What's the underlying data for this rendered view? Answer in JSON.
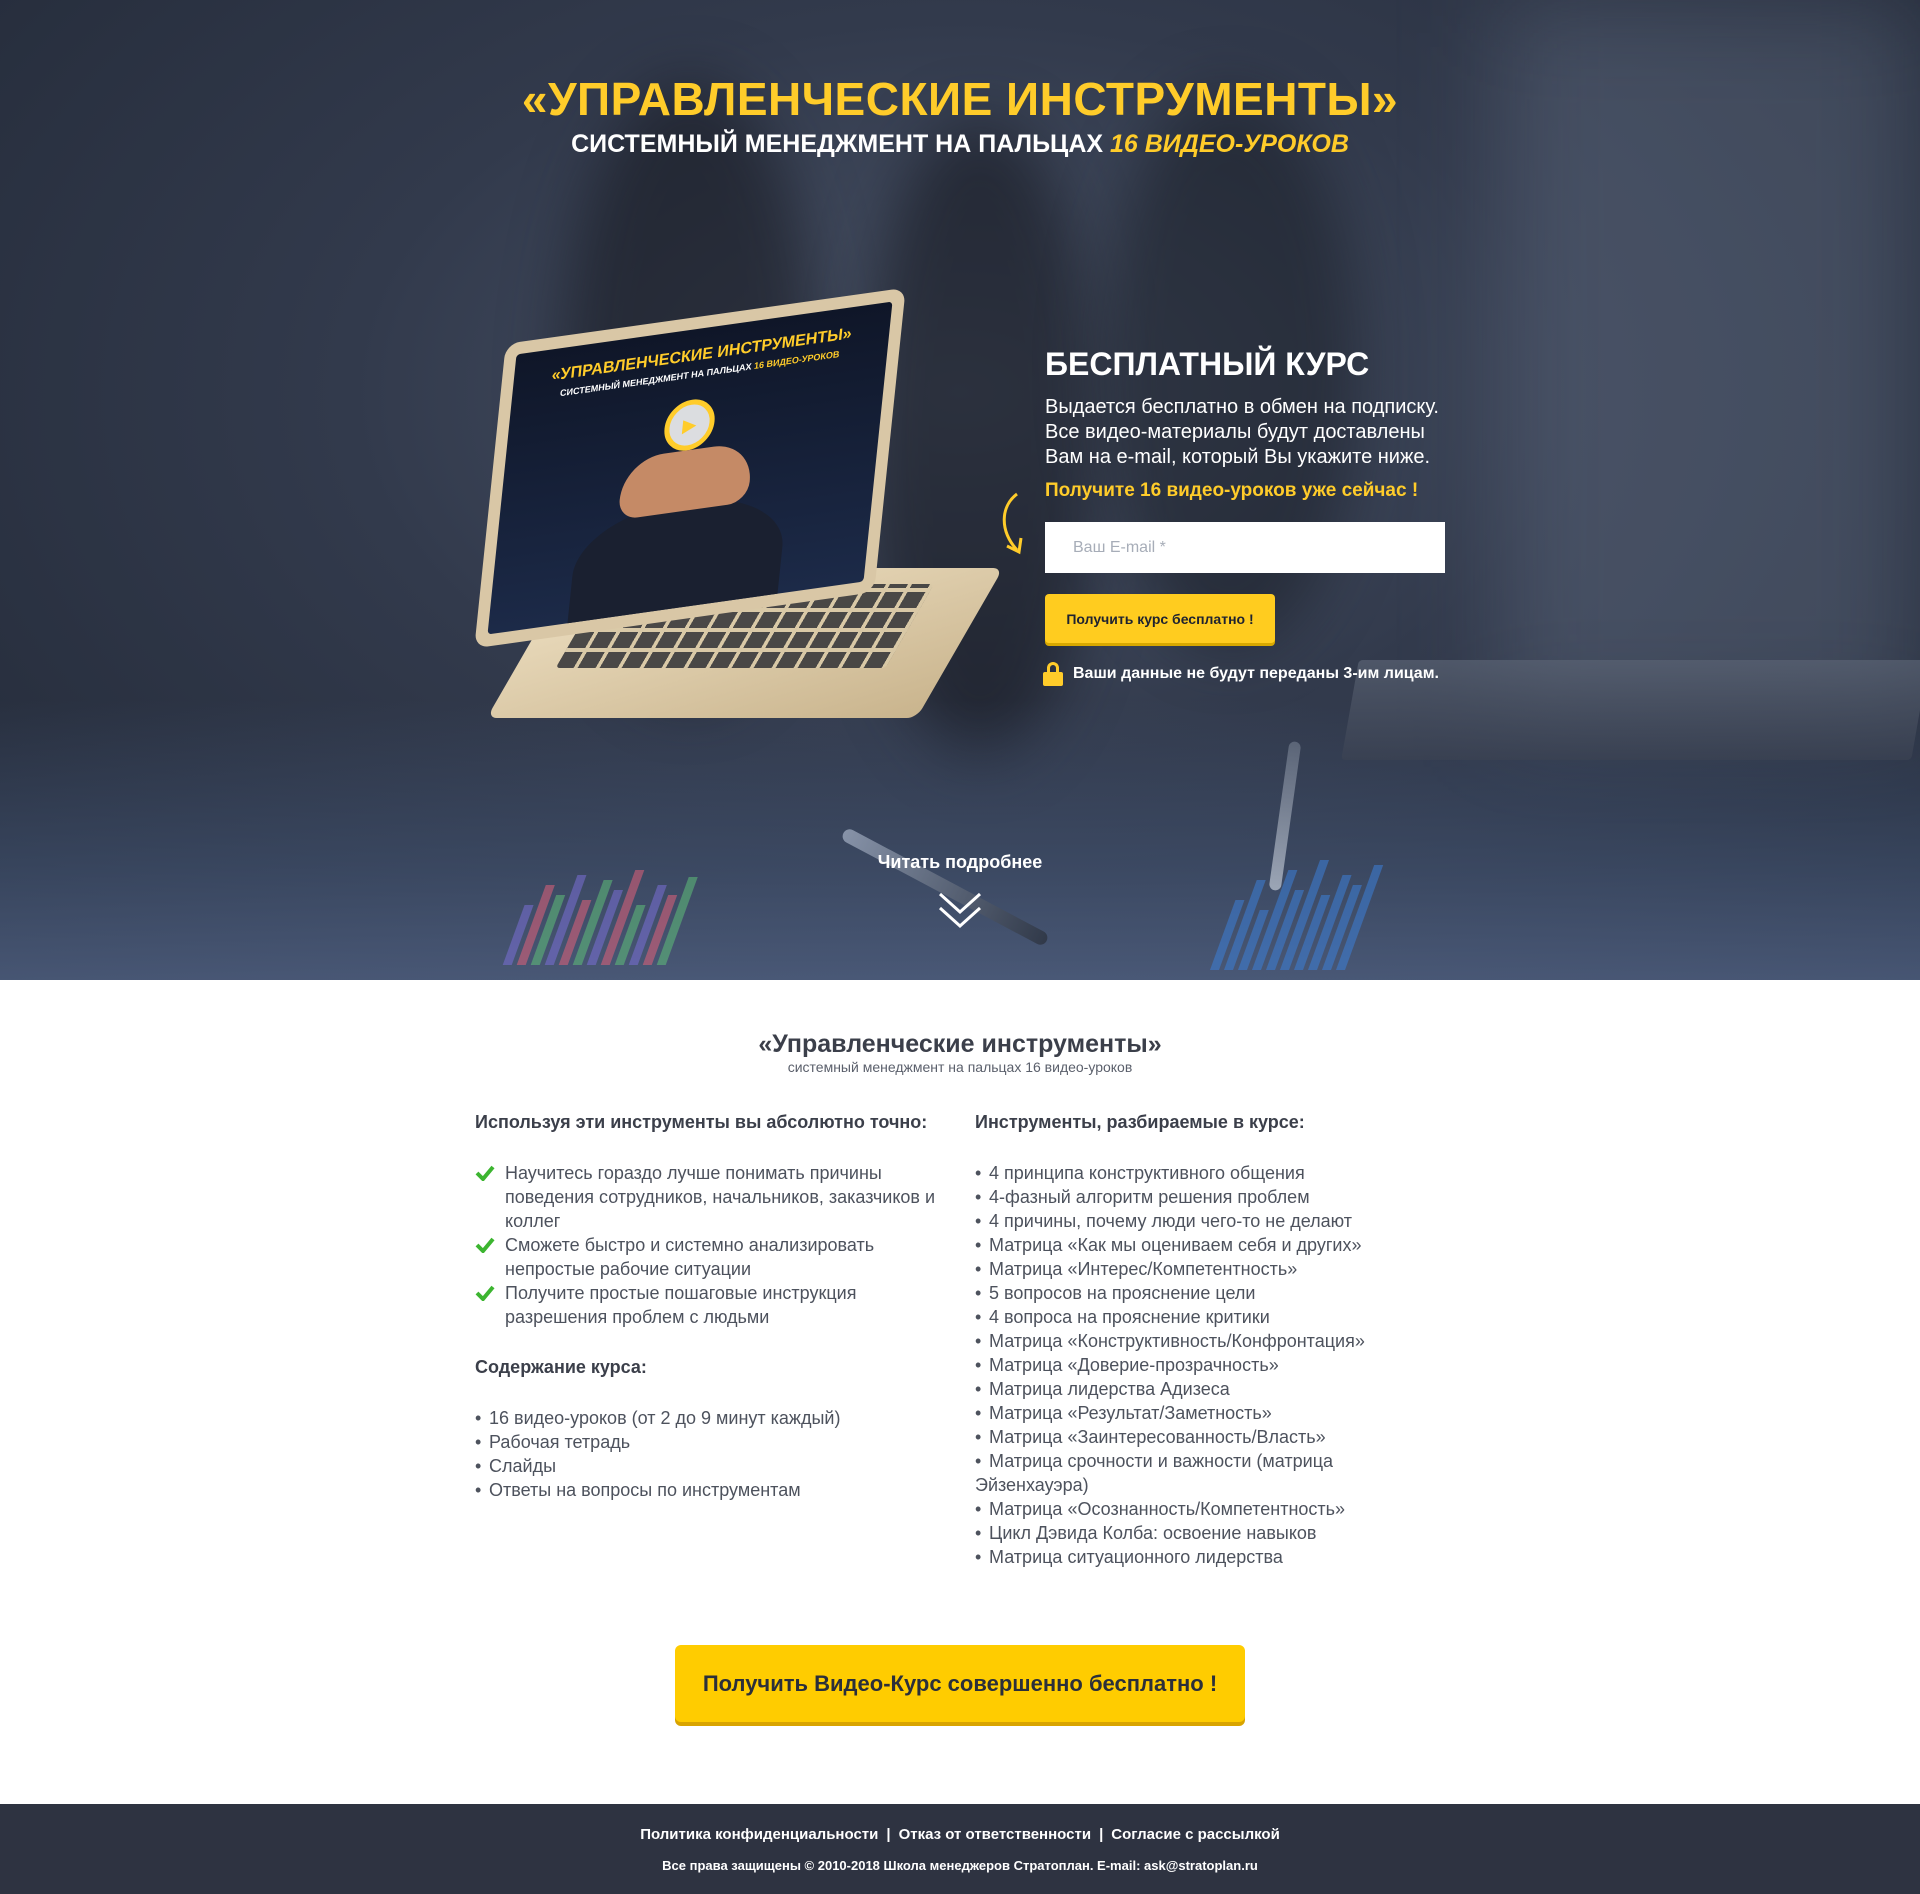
{
  "hero": {
    "title": "«УПРАВЛЕНЧЕСКИЕ ИНСТРУМЕНТЫ»",
    "subtitle_main": "СИСТЕМНЫЙ МЕНЕДЖМЕНТ НА ПАЛЬЦАХ ",
    "subtitle_accent": "16 ВИДЕО-УРОКОВ",
    "more_label": "Читать подробнее"
  },
  "laptop_screen": {
    "title": "«УПРАВЛЕНЧЕСКИЕ ИНСТРУМЕНТЫ»",
    "subtitle_main": "СИСТЕМНЫЙ МЕНЕДЖМЕНТ НА ПАЛЬЦАХ ",
    "subtitle_accent": "16 ВИДЕО-УРОКОВ"
  },
  "form": {
    "title": "БЕСПЛАТНЫЙ КУРС",
    "line1": "Выдается бесплатно в обмен на подписку.",
    "line2": "Все видео-материалы будут доставлены",
    "line3": "Вам на e-mail, который Вы укажите ниже.",
    "cta": "Получите 16 видео-уроков уже сейчас !",
    "email_placeholder": "Ваш E-mail *",
    "email_value": "",
    "submit_label": "Получить курс бесплатно !",
    "privacy": "Ваши данные не будут переданы 3-им лицам."
  },
  "content": {
    "title": "«Управленческие инструменты»",
    "subtitle": "системный менеджмент на пальцах 16 видео-уроков",
    "benefits_heading": "Используя эти инструменты вы абсолютно точно:",
    "benefits": [
      "Научитесь гораздо лучше понимать причины поведения сотрудников, начальников, заказчиков и коллег",
      "Сможете быстро и системно анализировать непростые рабочие ситуации",
      "Получите простые пошаговые инструкция разрешения проблем с людьми"
    ],
    "contents_heading": "Содержание курса:",
    "contents": [
      "16 видео-уроков (от 2 до 9 минут каждый)",
      "Рабочая тетрадь",
      "Слайды",
      "Ответы на вопросы по инструментам"
    ],
    "tools_heading": "Инструменты, разбираемые в курсе:",
    "tools": [
      "4 принципа конструктивного общения",
      "4-фазный алгоритм решения проблем",
      "4 причины, почему люди чего-то не делают",
      "Матрица «Как мы оцениваем себя и других»",
      "Матрица «Интерес/Компетентность»",
      "5 вопросов на прояснение цели",
      "4 вопроса на прояснение критики",
      "Матрица «Конструктивность/Конфронтация»",
      "Матрица «Доверие-прозрачность»",
      "Матрица лидерства Адизеса",
      "Матрица «Результат/Заметность»",
      "Матрица «Заинтересованность/Власть»",
      "Матрица срочности и важности (матрица Эйзенхауэра)",
      "Матрица «Осознанность/Компетентность»",
      "Цикл Дэвида Колба: освоение навыков",
      "Матрица ситуационного лидерства"
    ],
    "big_button_label": "Получить Видео-Курс совершенно бесплатно !"
  },
  "footer": {
    "links": [
      "Политика конфиденциальности",
      "Отказ от ответственности",
      "Согласие с рассылкой"
    ],
    "separator": "|",
    "copyright": "Все права защищены © 2010-2018 Школа менеджеров Стратоплан.  E-mail: ask@stratoplan.ru"
  },
  "colors": {
    "accent_yellow": "#ffcc2a",
    "button_yellow": "#ffcc00",
    "footer_bg": "#2e3341",
    "check_green": "#3cb530"
  },
  "icons": [
    "play-icon",
    "curved-arrow-icon",
    "lock-icon",
    "double-chevron-down-icon",
    "check-icon"
  ]
}
